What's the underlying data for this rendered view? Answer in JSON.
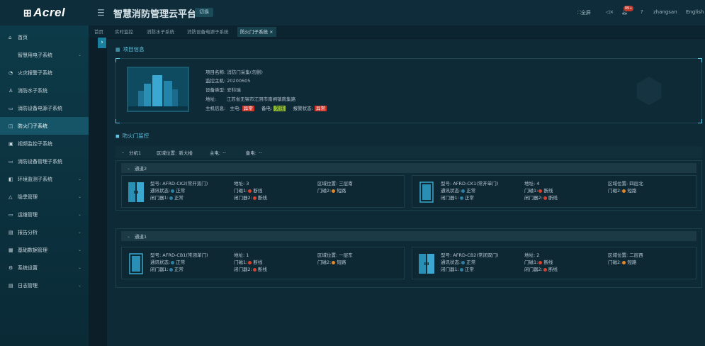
{
  "brand": {
    "mark": "⊞",
    "name": "Acrel"
  },
  "header": {
    "title": "智慧消防管理云平台",
    "switch_label": "切换",
    "fullscreen": "全屏",
    "user": "zhangsan",
    "lang": "English",
    "alarm_count": "99+"
  },
  "sidebar": {
    "items": [
      {
        "label": "首页",
        "icon": "⌂",
        "chev": ""
      },
      {
        "label": "智慧用电子系统",
        "icon": "",
        "chev": "⌄"
      },
      {
        "label": "火灾报警子系统",
        "icon": "◔",
        "chev": ""
      },
      {
        "label": "消防水子系统",
        "icon": "♙",
        "chev": ""
      },
      {
        "label": "消防设备电源子系统",
        "icon": "▭",
        "chev": ""
      },
      {
        "label": "防火门子系统",
        "icon": "◫",
        "chev": ""
      },
      {
        "label": "视频监控子系统",
        "icon": "▣",
        "chev": ""
      },
      {
        "label": "消防设备管理子系统",
        "icon": "▭",
        "chev": ""
      },
      {
        "label": "环境监测子系统",
        "icon": "◧",
        "chev": "⌄"
      },
      {
        "label": "隐患管理",
        "icon": "△",
        "chev": "⌄"
      },
      {
        "label": "运维管理",
        "icon": "▭",
        "chev": "⌄"
      },
      {
        "label": "报告分析",
        "icon": "▤",
        "chev": "⌄"
      },
      {
        "label": "基础数据管理",
        "icon": "▦",
        "chev": "⌄"
      },
      {
        "label": "系统设置",
        "icon": "⚙",
        "chev": "⌄"
      },
      {
        "label": "日志管理",
        "icon": "▤",
        "chev": "⌄"
      }
    ]
  },
  "tabs": [
    "首页",
    "实时监控",
    "消防水子系统",
    "消防设备电源子系统",
    "防火门子系统"
  ],
  "tab_close": "×",
  "project": {
    "section_title": "项目信息",
    "name_label": "项目名称:",
    "name": "消防门采集(勿删)",
    "host_label": "监控主机:",
    "host": "20200605",
    "type_label": "设备类型:",
    "type": "安科瑞",
    "addr_label": "地址:",
    "addr": "江苏省无锡市江阴市南闸镇南集路",
    "hostinfo_label": "主机信息:",
    "main_power_label": "主电:",
    "main_power": "异常",
    "backup_power_label": "备电:",
    "backup_power": "欠压",
    "alarm_label": "报警状态:",
    "alarm": "异常"
  },
  "monitor": {
    "section_title": "防火门监控",
    "branch": {
      "name": "分机1",
      "area_label": "区域位置:",
      "area": "新大楼",
      "main_label": "主电:",
      "main": "--",
      "backup_label": "备电:",
      "backup": "--"
    },
    "channels": [
      {
        "name": "通道2",
        "doors": [
          {
            "model": "型号: AFRD-CK2(常开双门)",
            "addr": "地址: 3",
            "area": "区域位置: 三层南",
            "comm": "通讯状态:",
            "comm_v": "正常",
            "door1": "门磁1:",
            "door1_v": "断线",
            "door2": "门磁2:",
            "door2_v": "短路",
            "close1": "闭门器1:",
            "close1_v": "正常",
            "close2": "闭门器2:",
            "close2_v": "断线"
          },
          {
            "model": "型号: AFRD-CK1(常开单门)",
            "addr": "地址: 4",
            "area": "区域位置: 四层北",
            "comm": "通讯状态:",
            "comm_v": "正常",
            "door1": "门磁1:",
            "door1_v": "断线",
            "door2": "门磁2:",
            "door2_v": "短路",
            "close1": "闭门器1:",
            "close1_v": "正常",
            "close2": "闭门器2:",
            "close2_v": "断线"
          }
        ]
      },
      {
        "name": "通道1",
        "doors": [
          {
            "model": "型号: AFRD-CB1(常闭单门)",
            "addr": "地址: 1",
            "area": "区域位置: 一层东",
            "comm": "通讯状态:",
            "comm_v": "正常",
            "door1": "门磁1:",
            "door1_v": "断线",
            "door2": "门磁2:",
            "door2_v": "短路",
            "close1": "闭门器1:",
            "close1_v": "正常",
            "close2": "闭门器2:",
            "close2_v": "断线"
          },
          {
            "model": "型号: AFRD-CB2(常闭双门)",
            "addr": "地址: 2",
            "area": "区域位置: 二层西",
            "comm": "通讯状态:",
            "comm_v": "正常",
            "door1": "门磁1:",
            "door1_v": "断线",
            "door2": "门磁2:",
            "door2_v": "短路",
            "close1": "闭门器1:",
            "close1_v": "正常",
            "close2": "闭门器2:",
            "close2_v": "断线"
          }
        ]
      }
    ]
  },
  "colors": {
    "accent": "#5ec3dc",
    "active_sidebar": "#155567",
    "error": "#c9342b",
    "warn": "#8fb93a"
  }
}
